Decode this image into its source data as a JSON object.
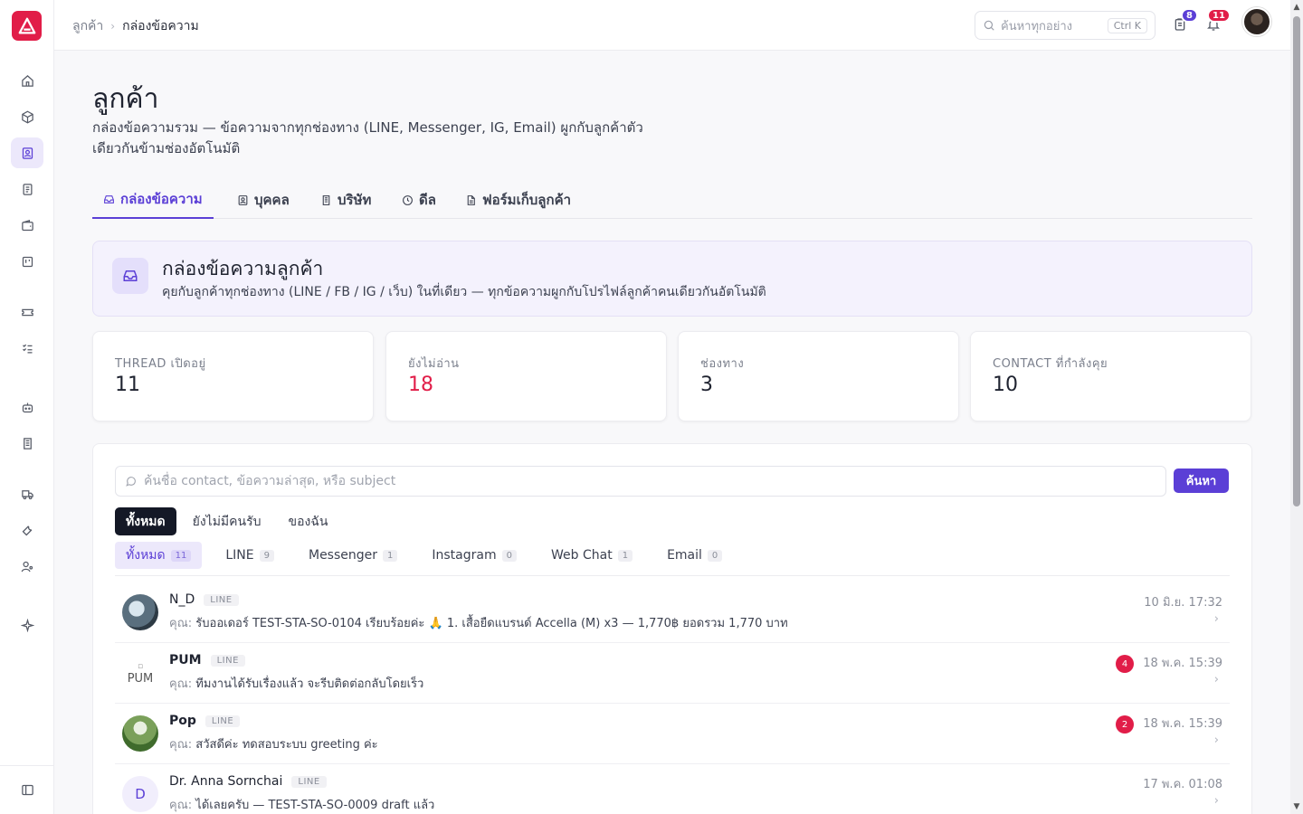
{
  "breadcrumb": {
    "parent": "ลูกค้า",
    "current": "กล่องข้อความ"
  },
  "topbar": {
    "search_placeholder": "ค้นหาทุกอย่าง",
    "search_shortcut": "Ctrl K",
    "tasks_badge": "8",
    "notifications_badge": "11"
  },
  "page": {
    "title": "ลูกค้า",
    "description": "กล่องข้อความรวม — ข้อความจากทุกช่องทาง (LINE, Messenger, IG, Email) ผูกกับลูกค้าตัวเดียวกันข้ามช่องอัตโนมัติ"
  },
  "tabs": [
    {
      "label": "กล่องข้อความ",
      "icon": "inbox-icon"
    },
    {
      "label": "บุคคล",
      "icon": "person-icon"
    },
    {
      "label": "บริษัท",
      "icon": "building-icon"
    },
    {
      "label": "ดีล",
      "icon": "clock-icon"
    },
    {
      "label": "ฟอร์มเก็บลูกค้า",
      "icon": "file-icon"
    }
  ],
  "hero": {
    "title": "กล่องข้อความลูกค้า",
    "subtitle": "คุยกับลูกค้าทุกช่องทาง (LINE / FB / IG / เว็บ) ในที่เดียว — ทุกข้อความผูกกับโปรไฟล์ลูกค้าคนเดียวกันอัตโนมัติ"
  },
  "stats": [
    {
      "label": "THREAD เปิดอยู่",
      "value": "11"
    },
    {
      "label": "ยังไม่อ่าน",
      "value": "18"
    },
    {
      "label": "ช่องทาง",
      "value": "3"
    },
    {
      "label": "CONTACT ที่กำลังคุย",
      "value": "10"
    }
  ],
  "search": {
    "placeholder": "ค้นชื่อ contact, ข้อความล่าสุด, หรือ subject",
    "button": "ค้นหา"
  },
  "filters": [
    "ทั้งหมด",
    "ยังไม่มีคนรับ",
    "ของฉัน"
  ],
  "channels": [
    {
      "label": "ทั้งหมด",
      "count": "11"
    },
    {
      "label": "LINE",
      "count": "9"
    },
    {
      "label": "Messenger",
      "count": "1"
    },
    {
      "label": "Instagram",
      "count": "0"
    },
    {
      "label": "Web Chat",
      "count": "1"
    },
    {
      "label": "Email",
      "count": "0"
    }
  ],
  "threads": [
    {
      "name": "N_D",
      "channel": "LINE",
      "you": "คุณ:",
      "message": "รับออเดอร์ TEST-STA-SO-0104 เรียบร้อยค่ะ 🙏 1. เสื้อยืดแบรนด์ Accella (M) x3 — 1,770฿ ยอดรวม 1,770 บาท",
      "time": "10 มิ.ย. 17:32",
      "unread": ""
    },
    {
      "name": "PUM",
      "channel": "LINE",
      "you": "คุณ:",
      "message": "ทีมงานได้รับเรื่องแล้ว จะรีบติดต่อกลับโดยเร็ว",
      "time": "18 พ.ค. 15:39",
      "unread": "4",
      "avatar_alt": "PUM"
    },
    {
      "name": "Pop",
      "channel": "LINE",
      "you": "คุณ:",
      "message": "สวัสดีค่ะ ทดสอบระบบ greeting ค่ะ",
      "time": "18 พ.ค. 15:39",
      "unread": "2"
    },
    {
      "name": "Dr. Anna Sornchai",
      "channel": "LINE",
      "you": "คุณ:",
      "message": "ได้เลยครับ — TEST-STA-SO-0009 draft แล้ว",
      "time": "17 พ.ค. 01:08",
      "unread": "",
      "initial": "D"
    }
  ],
  "colors": {
    "accent": "#5b3fd6",
    "brand": "#e11d48",
    "unread": "#e11d48"
  }
}
